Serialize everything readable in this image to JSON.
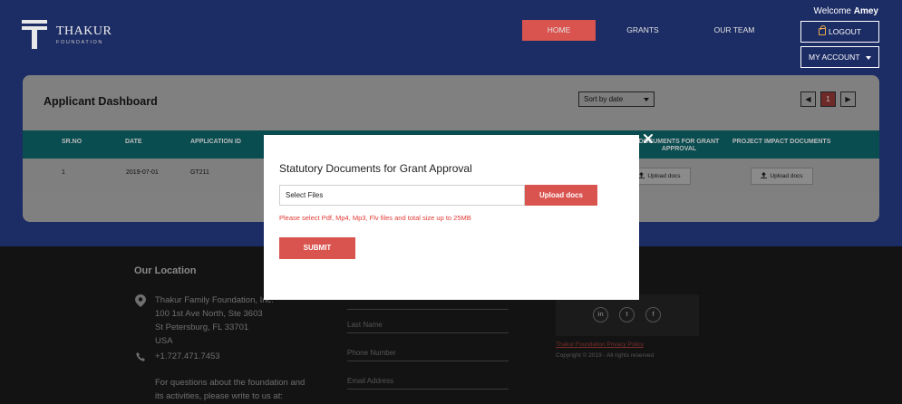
{
  "header": {
    "logo_text": "THAKUR",
    "logo_sub": "FOUNDATION",
    "nav": {
      "home": "HOME",
      "grants": "GRANTS",
      "team": "OUR TEAM"
    },
    "welcome_prefix": "Welcome",
    "user_name": "Amey",
    "logout_label": "LOGOUT",
    "account_label": "MY ACCOUNT"
  },
  "dashboard": {
    "title": "Applicant Dashboard",
    "sort_selected": "Sort by date",
    "pagination": {
      "prev": "◀",
      "current": "1",
      "next": "▶"
    },
    "columns": {
      "sr_no": "SR.NO",
      "date": "DATE",
      "application_id": "APPLICATION ID",
      "grant_docs": "DOCUMENTS FOR GRANT APPROVAL",
      "impact_docs": "PROJECT IMPACT DOCUMENTS"
    },
    "rows": [
      {
        "sr_no": "1",
        "date": "2019-07-01",
        "application_id": "GT211",
        "grant_upload": "Upload docs",
        "impact_upload": "Upload docs"
      }
    ]
  },
  "footer": {
    "location_heading": "Our Location",
    "address_lines": [
      "Thakur Family Foundation, Inc.",
      "100 1st Ave North, Ste 3603",
      "St Petersburg, FL 33701",
      "USA"
    ],
    "phone": "+1.727.471.7453",
    "contact_lines": [
      "For questions about the foundation and",
      "its activities, please write to us at:"
    ],
    "form_placeholders": {
      "last_name": "Last Name",
      "phone": "Phone Number",
      "email": "Email Address"
    },
    "social": {
      "linkedin": "in",
      "twitter": "t",
      "facebook": "f"
    },
    "privacy_link": "Thakur Foundation Privacy Policy",
    "copyright": "Copyright © 2019 - All rights reserved"
  },
  "modal": {
    "title": "Statutory Documents for Grant Approval",
    "file_label": "Select Files",
    "upload_label": "Upload docs",
    "hint": "Please select Pdf, Mp4, Mp3, Flv files and total size up to 25MB",
    "submit_label": "SUBMIT"
  },
  "colors": {
    "header_bg": "#1c2c64",
    "accent": "#d9534f",
    "table_header": "#0a4d51",
    "hint_text": "#e03b35"
  }
}
